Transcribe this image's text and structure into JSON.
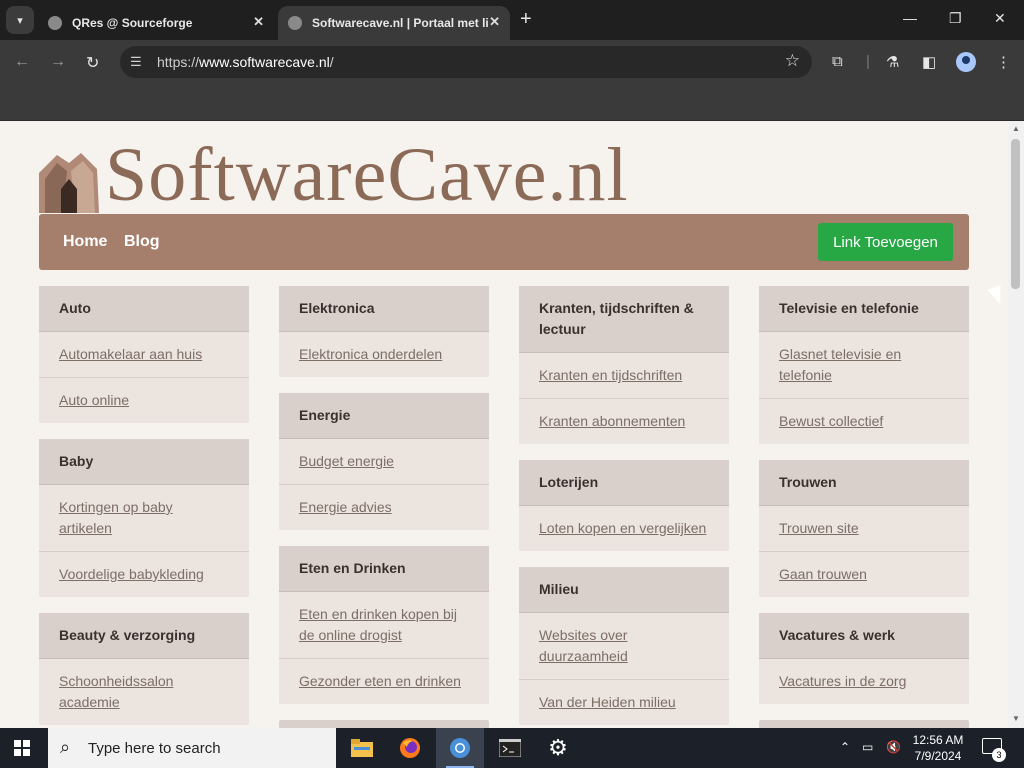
{
  "browser": {
    "tabs": [
      {
        "title": "QRes @ Sourceforge",
        "active": false
      },
      {
        "title": "Softwarecave.nl | Portaal met li",
        "active": true
      }
    ],
    "url_scheme": "https://",
    "url_host": "www.softwarecave.nl",
    "url_path": "/"
  },
  "site": {
    "logo_text": "SoftwareCave.nl",
    "nav": {
      "home": "Home",
      "blog": "Blog",
      "add_link": "Link Toevoegen"
    },
    "columns": [
      [
        {
          "title": "Auto",
          "items": [
            "Automakelaar aan huis",
            "Auto online"
          ]
        },
        {
          "title": "Baby",
          "items": [
            "Kortingen op baby artikelen",
            "Voordelige babykleding"
          ]
        },
        {
          "title": "Beauty & verzorging",
          "items": [
            "Schoonheidssalon academie"
          ]
        }
      ],
      [
        {
          "title": "Elektronica",
          "items": [
            "Elektronica onderdelen"
          ]
        },
        {
          "title": "Energie",
          "items": [
            "Budget energie",
            "Energie advies"
          ]
        },
        {
          "title": "Eten en Drinken",
          "items": [
            "Eten en drinken kopen bij de online drogist",
            "Gezonder eten en drinken"
          ]
        }
      ],
      [
        {
          "title": "Kranten, tijdschriften & lectuur",
          "items": [
            "Kranten en tijdschriften",
            "Kranten abonnementen"
          ]
        },
        {
          "title": "Loterijen",
          "items": [
            "Loten kopen en vergelijken"
          ]
        },
        {
          "title": "Milieu",
          "items": [
            "Websites over duurzaamheid",
            "Van der Heiden milieu"
          ]
        }
      ],
      [
        {
          "title": "Televisie en telefonie",
          "items": [
            "Glasnet televisie en telefonie",
            "Bewust collectief"
          ]
        },
        {
          "title": "Trouwen",
          "items": [
            "Trouwen site",
            "Gaan trouwen"
          ]
        },
        {
          "title": "Vacatures & werk",
          "items": [
            "Vacatures in de zorg"
          ]
        }
      ]
    ]
  },
  "taskbar": {
    "search_placeholder": "Type here to search",
    "time": "12:56 AM",
    "date": "7/9/2024",
    "notification_count": "3"
  },
  "colors": {
    "nav_bg": "#a57e6c",
    "add_button": "#28a745",
    "card_header": "#d9d0cc",
    "card_body": "#ebe4df",
    "link": "#7d6e66"
  }
}
